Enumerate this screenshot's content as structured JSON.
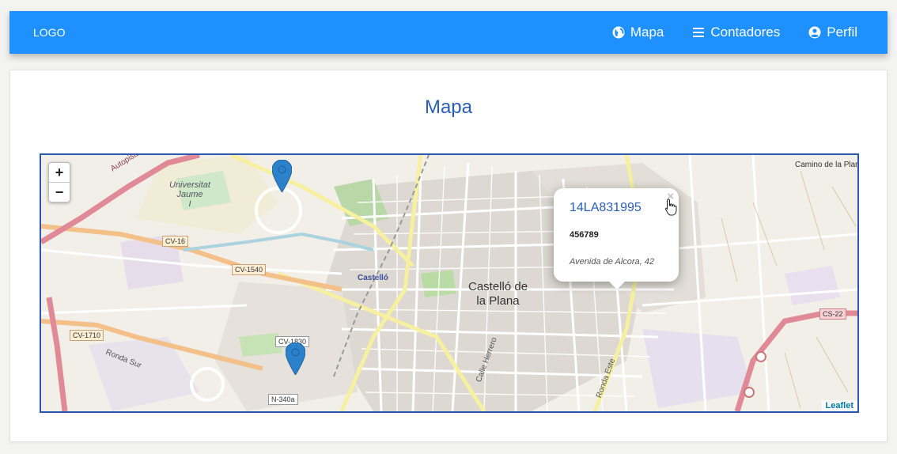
{
  "navbar": {
    "logo": "LOGO",
    "links": [
      {
        "label": "Mapa",
        "icon": "globe-icon"
      },
      {
        "label": "Contadores",
        "icon": "list-icon"
      },
      {
        "label": "Perfil",
        "icon": "user-icon"
      }
    ]
  },
  "page": {
    "title": "Mapa"
  },
  "map": {
    "zoom_in": "+",
    "zoom_out": "−",
    "attribution": "Leaflet",
    "labels": {
      "city": "Castelló de la Plana",
      "city_line1": "Castelló de",
      "city_line2": "la Plana",
      "castello_station": "Castelló",
      "university_line1": "Universitat",
      "university_line2": "Jaume",
      "university_line3": "I",
      "autopista": "Autopista del Mediterrani",
      "camino": "Camino de la Plana",
      "ronda_sur": "Ronda Sur",
      "ronda_este": "Ronda Este",
      "calle_herrero": "Calle Herrero",
      "road_labels": [
        "CV-16",
        "CV-1540",
        "CV-1710",
        "CV-1830",
        "N-340a",
        "CS-22"
      ]
    },
    "markers": [
      {
        "name": "marker-north",
        "color": "#2b82cb"
      },
      {
        "name": "marker-south",
        "color": "#2b82cb"
      }
    ],
    "popup": {
      "id": "14LA831995",
      "number": "456789",
      "address": "Avenida de Alcora, 42",
      "close": "×"
    }
  },
  "colors": {
    "navbar": "#1e90ff",
    "title": "#2a5db8",
    "map_border": "#2b57b0",
    "marker": "#2b82cb"
  }
}
